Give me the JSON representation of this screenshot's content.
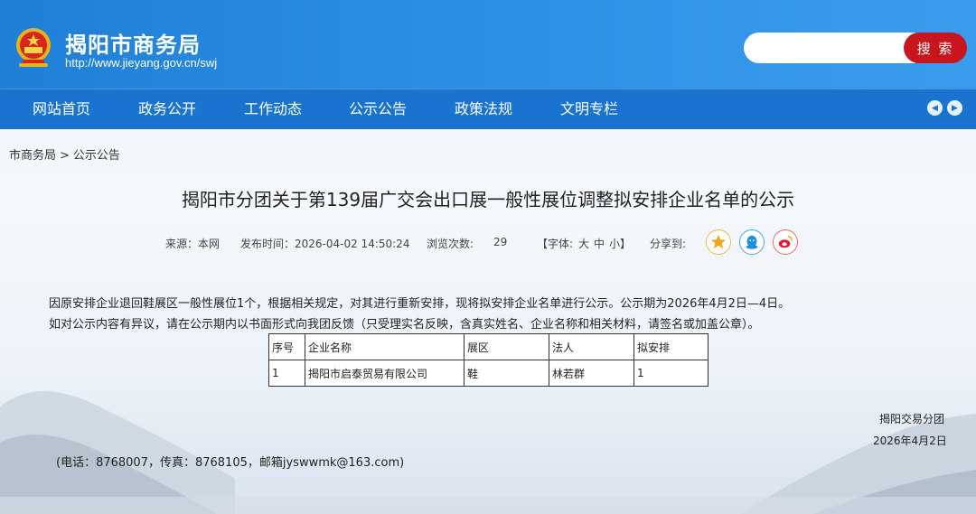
{
  "header": {
    "site_title": "揭阳市商务局",
    "site_url": "http://www.jieyang.gov.cn/swj",
    "search_placeholder": "",
    "search_button": "搜 索"
  },
  "nav": {
    "items": [
      "网站首页",
      "政务公开",
      "工作动态",
      "公示公告",
      "政策法规",
      "文明专栏"
    ]
  },
  "breadcrumb": {
    "home": "市商务局",
    "separator": ">",
    "current": "公示公告"
  },
  "article": {
    "title": "揭阳市分团关于第139届广交会出口展一般性展位调整拟安排企业名单的公示",
    "source_label": "来源：本网",
    "publish_label": "发布时间：2026-04-02 14:50:24",
    "views_label": "浏览次数:",
    "views_value": "29",
    "font_label": "【字体:",
    "font_large": "大",
    "font_medium": "中",
    "font_small": "小】",
    "share_label": "分享到:",
    "paragraph1": "因原安排企业退回鞋展区一般性展位1个，根据相关规定，对其进行重新安排，现将拟安排企业名单进行公示。公示期为2026年4月2日—4日。",
    "paragraph2": "如对公示内容有异议，请在公示期内以书面形式向我团反馈（只受理实名反映，含真实姓名、企业名称和相关材料，请签名或加盖公章）。",
    "table": {
      "headers": [
        "序号",
        "企业名称",
        "展区",
        "法人",
        "拟安排"
      ],
      "rows": [
        [
          "1",
          "揭阳市启泰贸易有限公司",
          "鞋",
          "林若群",
          "1"
        ]
      ]
    },
    "signature_org": "揭阳交易分团",
    "signature_date": "2026年4月2日",
    "contact": "(电话：8768007，传真：8768105，邮箱jyswwmk@163.com)"
  },
  "colors": {
    "header_blue": "#2a8fe4",
    "nav_blue": "#1a74cf",
    "search_red": "#c8161e"
  },
  "icons": [
    "emblem-icon",
    "prev-arrow-icon",
    "next-arrow-icon",
    "qzone-star-icon",
    "qq-icon",
    "weibo-icon"
  ]
}
